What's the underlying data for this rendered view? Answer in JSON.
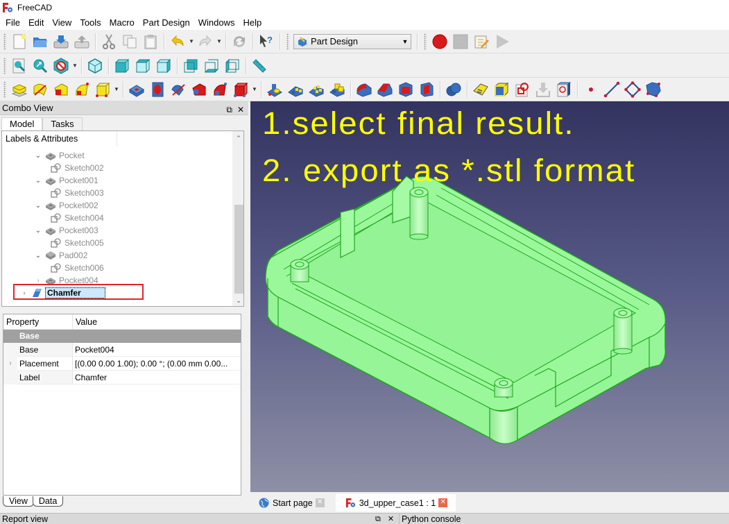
{
  "window": {
    "title": "FreeCAD",
    "app_icon": "freecad-logo-icon"
  },
  "menu": [
    "File",
    "Edit",
    "View",
    "Tools",
    "Macro",
    "Part Design",
    "Windows",
    "Help"
  ],
  "toolbar": {
    "file_tools": [
      "new-document-icon",
      "open-folder-icon",
      "save-icon",
      "save-as-icon"
    ],
    "edit_tools": [
      "cut-icon",
      "copy-icon",
      "paste-icon",
      "undo-icon",
      "redo-icon",
      "refresh-icon",
      "whats-this-icon"
    ],
    "workbench_selector": {
      "value": "Part Design",
      "icon": "part-design-icon"
    },
    "macro_tools": [
      "record-macro-icon",
      "stop-macro-icon",
      "edit-macro-icon",
      "run-macro-icon"
    ],
    "view_tools": [
      "fit-all-icon",
      "fit-selection-icon",
      "draw-style-icon",
      "isometric-view-icon",
      "front-view-icon",
      "top-view-icon",
      "right-view-icon",
      "rear-view-icon",
      "bottom-view-icon",
      "left-view-icon",
      "measure-icon"
    ],
    "part_design_tools": [
      "pad-icon",
      "revolution-icon",
      "additive-loft-icon",
      "additive-pipe-icon",
      "additive-primitive-icon",
      "pocket-icon",
      "hole-icon",
      "groove-icon",
      "subtractive-loft-icon",
      "subtractive-pipe-icon",
      "subtractive-primitive-icon",
      "mirrored-icon",
      "linear-pattern-icon",
      "polar-pattern-icon",
      "multi-transform-icon",
      "fillet-icon",
      "chamfer-icon",
      "draft-icon",
      "thickness-icon",
      "boolean-icon",
      "shape-binder-icon",
      "clone-icon",
      "sketch-icon",
      "import-icon",
      "validate-sketch-icon",
      "datum-point-icon",
      "datum-line-icon",
      "datum-plane-icon",
      "local-cs-icon"
    ]
  },
  "combo_view": {
    "title": "Combo View",
    "tabs": [
      "Model",
      "Tasks"
    ],
    "active_tab": "Model",
    "tree_header": "Labels & Attributes",
    "tree_items": [
      {
        "label": "Pocket",
        "type": "pocket",
        "level": 1,
        "expanded": true
      },
      {
        "label": "Sketch002",
        "type": "sketch",
        "level": 2
      },
      {
        "label": "Pocket001",
        "type": "pocket",
        "level": 1,
        "expanded": true
      },
      {
        "label": "Sketch003",
        "type": "sketch",
        "level": 2
      },
      {
        "label": "Pocket002",
        "type": "pocket",
        "level": 1,
        "expanded": true
      },
      {
        "label": "Sketch004",
        "type": "sketch",
        "level": 2
      },
      {
        "label": "Pocket003",
        "type": "pocket",
        "level": 1,
        "expanded": true
      },
      {
        "label": "Sketch005",
        "type": "sketch",
        "level": 2
      },
      {
        "label": "Pad002",
        "type": "pad",
        "level": 1,
        "expanded": true
      },
      {
        "label": "Sketch006",
        "type": "sketch",
        "level": 2
      },
      {
        "label": "Pocket004",
        "type": "pocket",
        "level": 1,
        "expanded": false
      },
      {
        "label": "Chamfer",
        "type": "chamfer",
        "level": 0,
        "expanded": false,
        "selected": true
      }
    ],
    "property_headers": [
      "Property",
      "Value"
    ],
    "property_group": "Base",
    "properties": [
      {
        "name": "Base",
        "value": "Pocket004",
        "expandable": false
      },
      {
        "name": "Placement",
        "value": "[(0.00 0.00 1.00); 0.00 °; (0.00 mm  0.00...",
        "expandable": true
      },
      {
        "name": "Label",
        "value": "Chamfer",
        "expandable": false
      }
    ],
    "bottom_tabs": [
      "View",
      "Data"
    ],
    "active_bottom_tab": "Data"
  },
  "viewport": {
    "annotation_line1": "1.select final result.",
    "annotation_line2": "2. export as *.stl format",
    "annotation_color": "#ffff00",
    "model_color": "#90f090",
    "edge_color": "#1fa81f",
    "selection_highlight_color": "#e1242c"
  },
  "document_tabs": [
    {
      "label": "Start page",
      "icon": "globe-icon",
      "active": false
    },
    {
      "label": "3d_upper_case1 : 1",
      "icon": "freecad-logo-icon",
      "active": true
    }
  ],
  "bottom_dock": {
    "report_title": "Report view",
    "python_title": "Python console"
  }
}
